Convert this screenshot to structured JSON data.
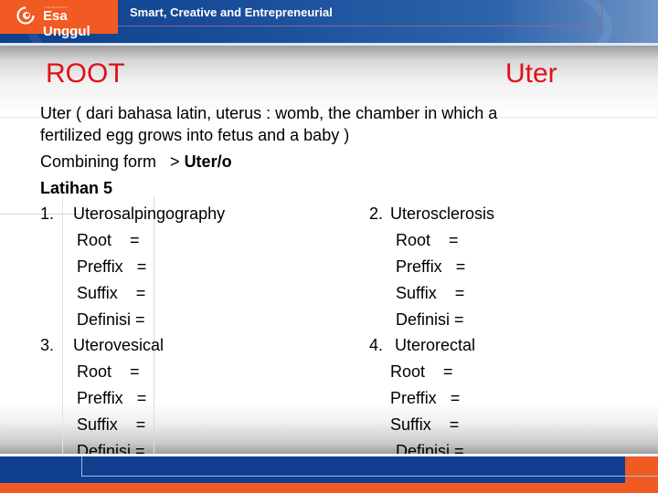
{
  "header": {
    "logo_small": "UNIVERSITAS",
    "logo_text": "Esa Unggul",
    "tagline": "Smart, Creative and Entrepreneurial",
    "colors": {
      "orange": "#f15a22",
      "blue": "#0f3f8e"
    }
  },
  "slide": {
    "title_left": "ROOT",
    "title_right": "Uter",
    "title_color": "#e0101a",
    "definition_line1": "Uter ( dari bahasa latin, uterus : womb, the chamber in which a",
    "definition_line2": "fertilized egg grows into fetus and a baby )",
    "combining_label": "Combining form   > ",
    "combining_value": "Uter/o",
    "exercise_title": "Latihan 5",
    "items": [
      {
        "number": "1.",
        "term": "Uterosalpingography",
        "root": "Root    =",
        "prefix": "Preffix   =",
        "suffix": "Suffix    =",
        "definisi": "Definisi ="
      },
      {
        "number": "2.",
        "term": "Uterosclerosis",
        "root": "Root    =",
        "prefix": "Preffix   =",
        "suffix": "Suffix    =",
        "definisi": "Definisi ="
      },
      {
        "number": "3.",
        "term": "Uterovesical",
        "root": "Root    =",
        "prefix": "Preffix   =",
        "suffix": "Suffix    =",
        "definisi": "Definisi ="
      },
      {
        "number": "4.",
        "term": "Uterorectal",
        "root": "Root    =",
        "prefix": "Preffix   =",
        "suffix": "Suffix    =",
        "definisi": "Definisi ="
      }
    ]
  }
}
